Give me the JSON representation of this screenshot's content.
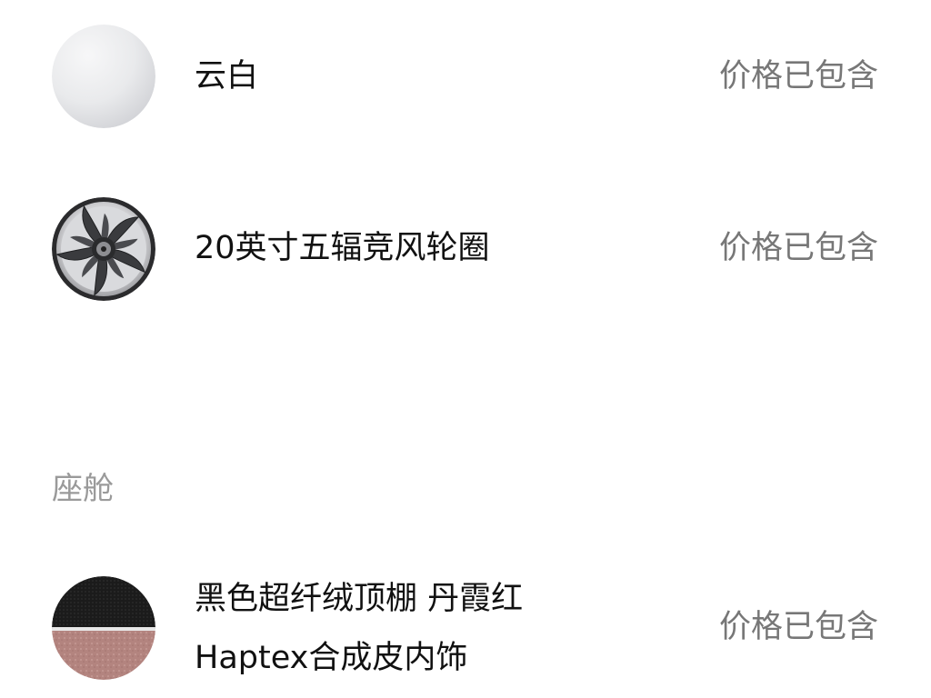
{
  "exterior": {
    "color_option": {
      "name": "云白",
      "price_status": "价格已包含",
      "swatch_color": "#e6e7ea"
    },
    "wheel_option": {
      "name": "20英寸五辐竞风轮圈",
      "price_status": "价格已包含"
    }
  },
  "cabin": {
    "section_title": "座舱",
    "interior_option": {
      "name_line1": "黑色超纤绒顶棚 丹霞红",
      "name_line2": "Haptex合成皮内饰",
      "price_status": "价格已包含",
      "top_color": "#1c1c1c",
      "bottom_color": "#b58a85"
    }
  }
}
